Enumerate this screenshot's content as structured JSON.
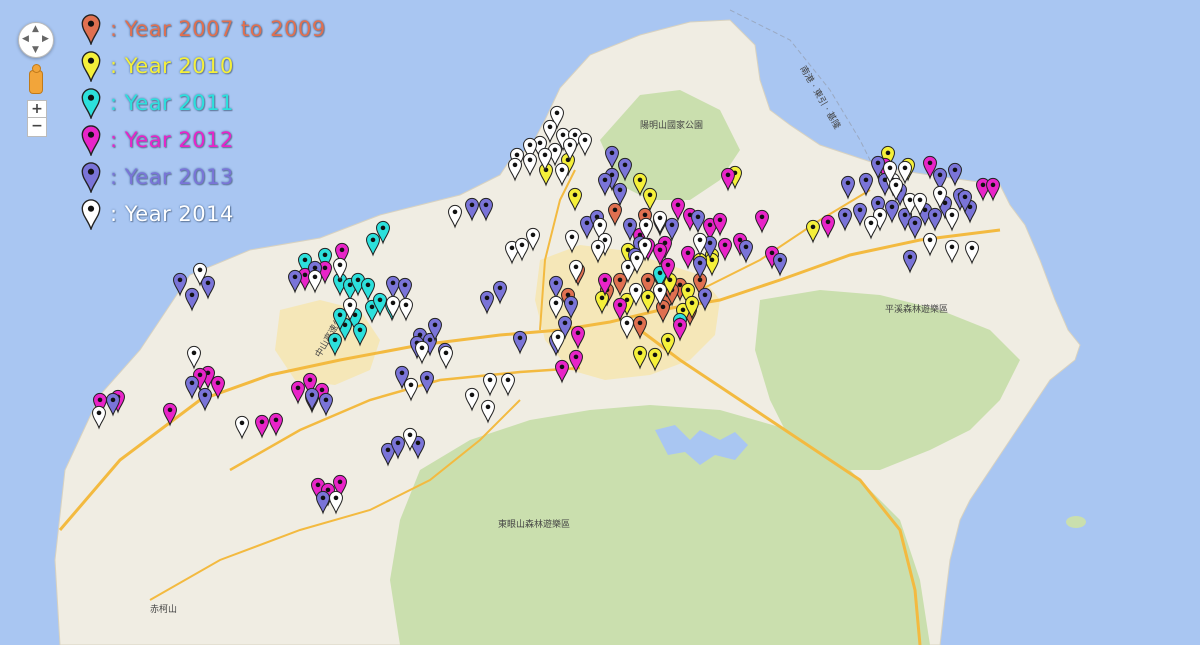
{
  "legend": [
    {
      "label": ": Year 2007 to 2009",
      "color": "#e07050"
    },
    {
      "label": ": Year 2010",
      "color": "#f5f03a"
    },
    {
      "label": ": Year 2011",
      "color": "#2ce0dc"
    },
    {
      "label": ": Year 2012",
      "color": "#e824c8"
    },
    {
      "label": ": Year 2013",
      "color": "#7a74d8"
    },
    {
      "label": ": Year 2014",
      "color": "#ffffff"
    }
  ],
  "controls": {
    "zoom_in": "+",
    "zoom_out": "−"
  },
  "map_labels": {
    "yangmingshan": "陽明山國家公園",
    "pinglin": "平溪森林遊樂區",
    "dongyan": "東眼山森林遊樂區",
    "chikeshan": "赤柯山",
    "highway": "南港 · 東引 · 基隆",
    "zhongshan": "中山高速公路"
  },
  "colors": {
    "sea": "#a9c6f2",
    "land": "#f0ede3",
    "green": "#cadfae",
    "city": "#f5e7b8",
    "road": "#f3ba40"
  },
  "markers": {
    "y0709": [
      [
        615,
        225
      ],
      [
        578,
        285
      ],
      [
        568,
        310
      ],
      [
        607,
        305
      ],
      [
        620,
        295
      ],
      [
        648,
        295
      ],
      [
        668,
        310
      ],
      [
        640,
        338
      ],
      [
        663,
        322
      ],
      [
        680,
        300
      ],
      [
        672,
        305
      ],
      [
        690,
        325
      ],
      [
        700,
        295
      ],
      [
        645,
        230
      ]
    ],
    "y2010": [
      [
        546,
        185
      ],
      [
        568,
        175
      ],
      [
        575,
        210
      ],
      [
        640,
        195
      ],
      [
        650,
        210
      ],
      [
        712,
        270
      ],
      [
        735,
        188
      ],
      [
        813,
        242
      ],
      [
        888,
        168
      ],
      [
        908,
        180
      ],
      [
        602,
        313
      ],
      [
        627,
        315
      ],
      [
        648,
        312
      ],
      [
        670,
        295
      ],
      [
        688,
        305
      ],
      [
        683,
        325
      ],
      [
        692,
        318
      ],
      [
        640,
        368
      ],
      [
        655,
        370
      ],
      [
        668,
        355
      ],
      [
        712,
        275
      ],
      [
        628,
        265
      ],
      [
        660,
        290
      ],
      [
        700,
        275
      ]
    ],
    "y2011": [
      [
        383,
        243
      ],
      [
        373,
        255
      ],
      [
        305,
        275
      ],
      [
        325,
        270
      ],
      [
        340,
        295
      ],
      [
        350,
        300
      ],
      [
        358,
        295
      ],
      [
        368,
        300
      ],
      [
        372,
        322
      ],
      [
        355,
        330
      ],
      [
        345,
        340
      ],
      [
        335,
        355
      ],
      [
        380,
        315
      ],
      [
        392,
        320
      ],
      [
        660,
        288
      ],
      [
        680,
        335
      ],
      [
        340,
        330
      ],
      [
        360,
        345
      ]
    ],
    "y2012": [
      [
        342,
        265
      ],
      [
        325,
        283
      ],
      [
        305,
        290
      ],
      [
        208,
        388
      ],
      [
        218,
        398
      ],
      [
        200,
        390
      ],
      [
        170,
        425
      ],
      [
        118,
        412
      ],
      [
        100,
        415
      ],
      [
        298,
        403
      ],
      [
        310,
        395
      ],
      [
        322,
        405
      ],
      [
        312,
        412
      ],
      [
        262,
        437
      ],
      [
        276,
        435
      ],
      [
        318,
        500
      ],
      [
        340,
        497
      ],
      [
        328,
        505
      ],
      [
        578,
        348
      ],
      [
        562,
        382
      ],
      [
        576,
        372
      ],
      [
        605,
        295
      ],
      [
        620,
        320
      ],
      [
        640,
        250
      ],
      [
        665,
        258
      ],
      [
        678,
        220
      ],
      [
        690,
        230
      ],
      [
        710,
        240
      ],
      [
        720,
        235
      ],
      [
        740,
        255
      ],
      [
        725,
        260
      ],
      [
        728,
        190
      ],
      [
        762,
        232
      ],
      [
        772,
        268
      ],
      [
        828,
        237
      ],
      [
        930,
        178
      ],
      [
        983,
        200
      ],
      [
        993,
        200
      ],
      [
        885,
        180
      ],
      [
        660,
        265
      ],
      [
        688,
        268
      ],
      [
        668,
        280
      ],
      [
        680,
        340
      ],
      [
        648,
        260
      ]
    ],
    "y2013": [
      [
        208,
        298
      ],
      [
        180,
        295
      ],
      [
        192,
        310
      ],
      [
        295,
        292
      ],
      [
        315,
        283
      ],
      [
        393,
        298
      ],
      [
        405,
        300
      ],
      [
        500,
        303
      ],
      [
        487,
        313
      ],
      [
        472,
        220
      ],
      [
        486,
        220
      ],
      [
        520,
        353
      ],
      [
        556,
        298
      ],
      [
        571,
        318
      ],
      [
        565,
        338
      ],
      [
        556,
        355
      ],
      [
        587,
        238
      ],
      [
        597,
        232
      ],
      [
        612,
        168
      ],
      [
        625,
        180
      ],
      [
        612,
        190
      ],
      [
        630,
        240
      ],
      [
        640,
        258
      ],
      [
        660,
        235
      ],
      [
        672,
        240
      ],
      [
        698,
        232
      ],
      [
        710,
        258
      ],
      [
        700,
        278
      ],
      [
        746,
        262
      ],
      [
        780,
        275
      ],
      [
        848,
        198
      ],
      [
        866,
        195
      ],
      [
        878,
        178
      ],
      [
        885,
        195
      ],
      [
        860,
        225
      ],
      [
        845,
        230
      ],
      [
        878,
        218
      ],
      [
        892,
        222
      ],
      [
        900,
        205
      ],
      [
        905,
        230
      ],
      [
        915,
        238
      ],
      [
        925,
        225
      ],
      [
        935,
        230
      ],
      [
        945,
        218
      ],
      [
        955,
        185
      ],
      [
        960,
        210
      ],
      [
        970,
        222
      ],
      [
        910,
        272
      ],
      [
        940,
        190
      ],
      [
        965,
        212
      ],
      [
        420,
        350
      ],
      [
        430,
        355
      ],
      [
        435,
        340
      ],
      [
        445,
        365
      ],
      [
        417,
        358
      ],
      [
        192,
        398
      ],
      [
        205,
        410
      ],
      [
        402,
        388
      ],
      [
        427,
        393
      ],
      [
        388,
        465
      ],
      [
        398,
        458
      ],
      [
        418,
        458
      ],
      [
        323,
        513
      ],
      [
        312,
        410
      ],
      [
        326,
        415
      ],
      [
        113,
        415
      ],
      [
        605,
        195
      ],
      [
        620,
        205
      ],
      [
        635,
        270
      ],
      [
        705,
        310
      ]
    ],
    "y2014": [
      [
        200,
        285
      ],
      [
        194,
        368
      ],
      [
        99,
        428
      ],
      [
        242,
        438
      ],
      [
        336,
        513
      ],
      [
        557,
        128
      ],
      [
        550,
        142
      ],
      [
        563,
        150
      ],
      [
        575,
        150
      ],
      [
        585,
        155
      ],
      [
        570,
        160
      ],
      [
        555,
        165
      ],
      [
        540,
        158
      ],
      [
        530,
        160
      ],
      [
        517,
        170
      ],
      [
        530,
        175
      ],
      [
        545,
        170
      ],
      [
        515,
        180
      ],
      [
        562,
        185
      ],
      [
        600,
        240
      ],
      [
        605,
        255
      ],
      [
        636,
        305
      ],
      [
        627,
        338
      ],
      [
        646,
        240
      ],
      [
        660,
        233
      ],
      [
        315,
        292
      ],
      [
        340,
        280
      ],
      [
        350,
        320
      ],
      [
        393,
        318
      ],
      [
        406,
        320
      ],
      [
        455,
        227
      ],
      [
        512,
        263
      ],
      [
        522,
        260
      ],
      [
        533,
        250
      ],
      [
        556,
        318
      ],
      [
        558,
        352
      ],
      [
        576,
        282
      ],
      [
        572,
        252
      ],
      [
        422,
        363
      ],
      [
        446,
        368
      ],
      [
        411,
        400
      ],
      [
        472,
        410
      ],
      [
        490,
        395
      ],
      [
        488,
        422
      ],
      [
        508,
        395
      ],
      [
        410,
        450
      ],
      [
        628,
        282
      ],
      [
        645,
        260
      ],
      [
        598,
        262
      ],
      [
        637,
        273
      ],
      [
        880,
        230
      ],
      [
        871,
        238
      ],
      [
        893,
        195
      ],
      [
        905,
        183
      ],
      [
        910,
        215
      ],
      [
        920,
        215
      ],
      [
        930,
        255
      ],
      [
        952,
        262
      ],
      [
        972,
        263
      ],
      [
        940,
        208
      ],
      [
        952,
        230
      ],
      [
        890,
        183
      ],
      [
        896,
        200
      ],
      [
        660,
        305
      ],
      [
        700,
        255
      ]
    ]
  }
}
